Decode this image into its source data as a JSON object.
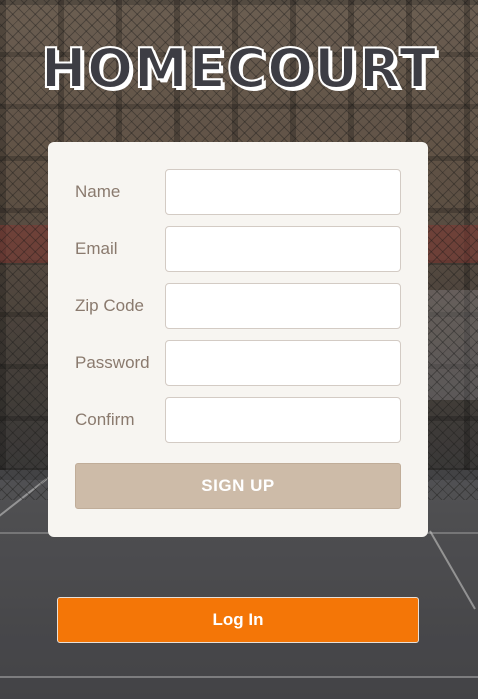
{
  "app": {
    "logo_text": "HOMECOURT"
  },
  "form": {
    "fields": [
      {
        "label": "Name",
        "value": "",
        "placeholder": ""
      },
      {
        "label": "Email",
        "value": "",
        "placeholder": ""
      },
      {
        "label": "Zip Code",
        "value": "",
        "placeholder": ""
      },
      {
        "label": "Password",
        "value": "",
        "placeholder": ""
      },
      {
        "label": "Confirm",
        "value": "",
        "placeholder": ""
      }
    ],
    "signup_label": "SIGN UP"
  },
  "login_label": "Log In",
  "colors": {
    "accent": "#f47607",
    "signup_button": "#cdbba8",
    "card_background": "#f7f5f1",
    "label_text": "#8a7a6e"
  }
}
